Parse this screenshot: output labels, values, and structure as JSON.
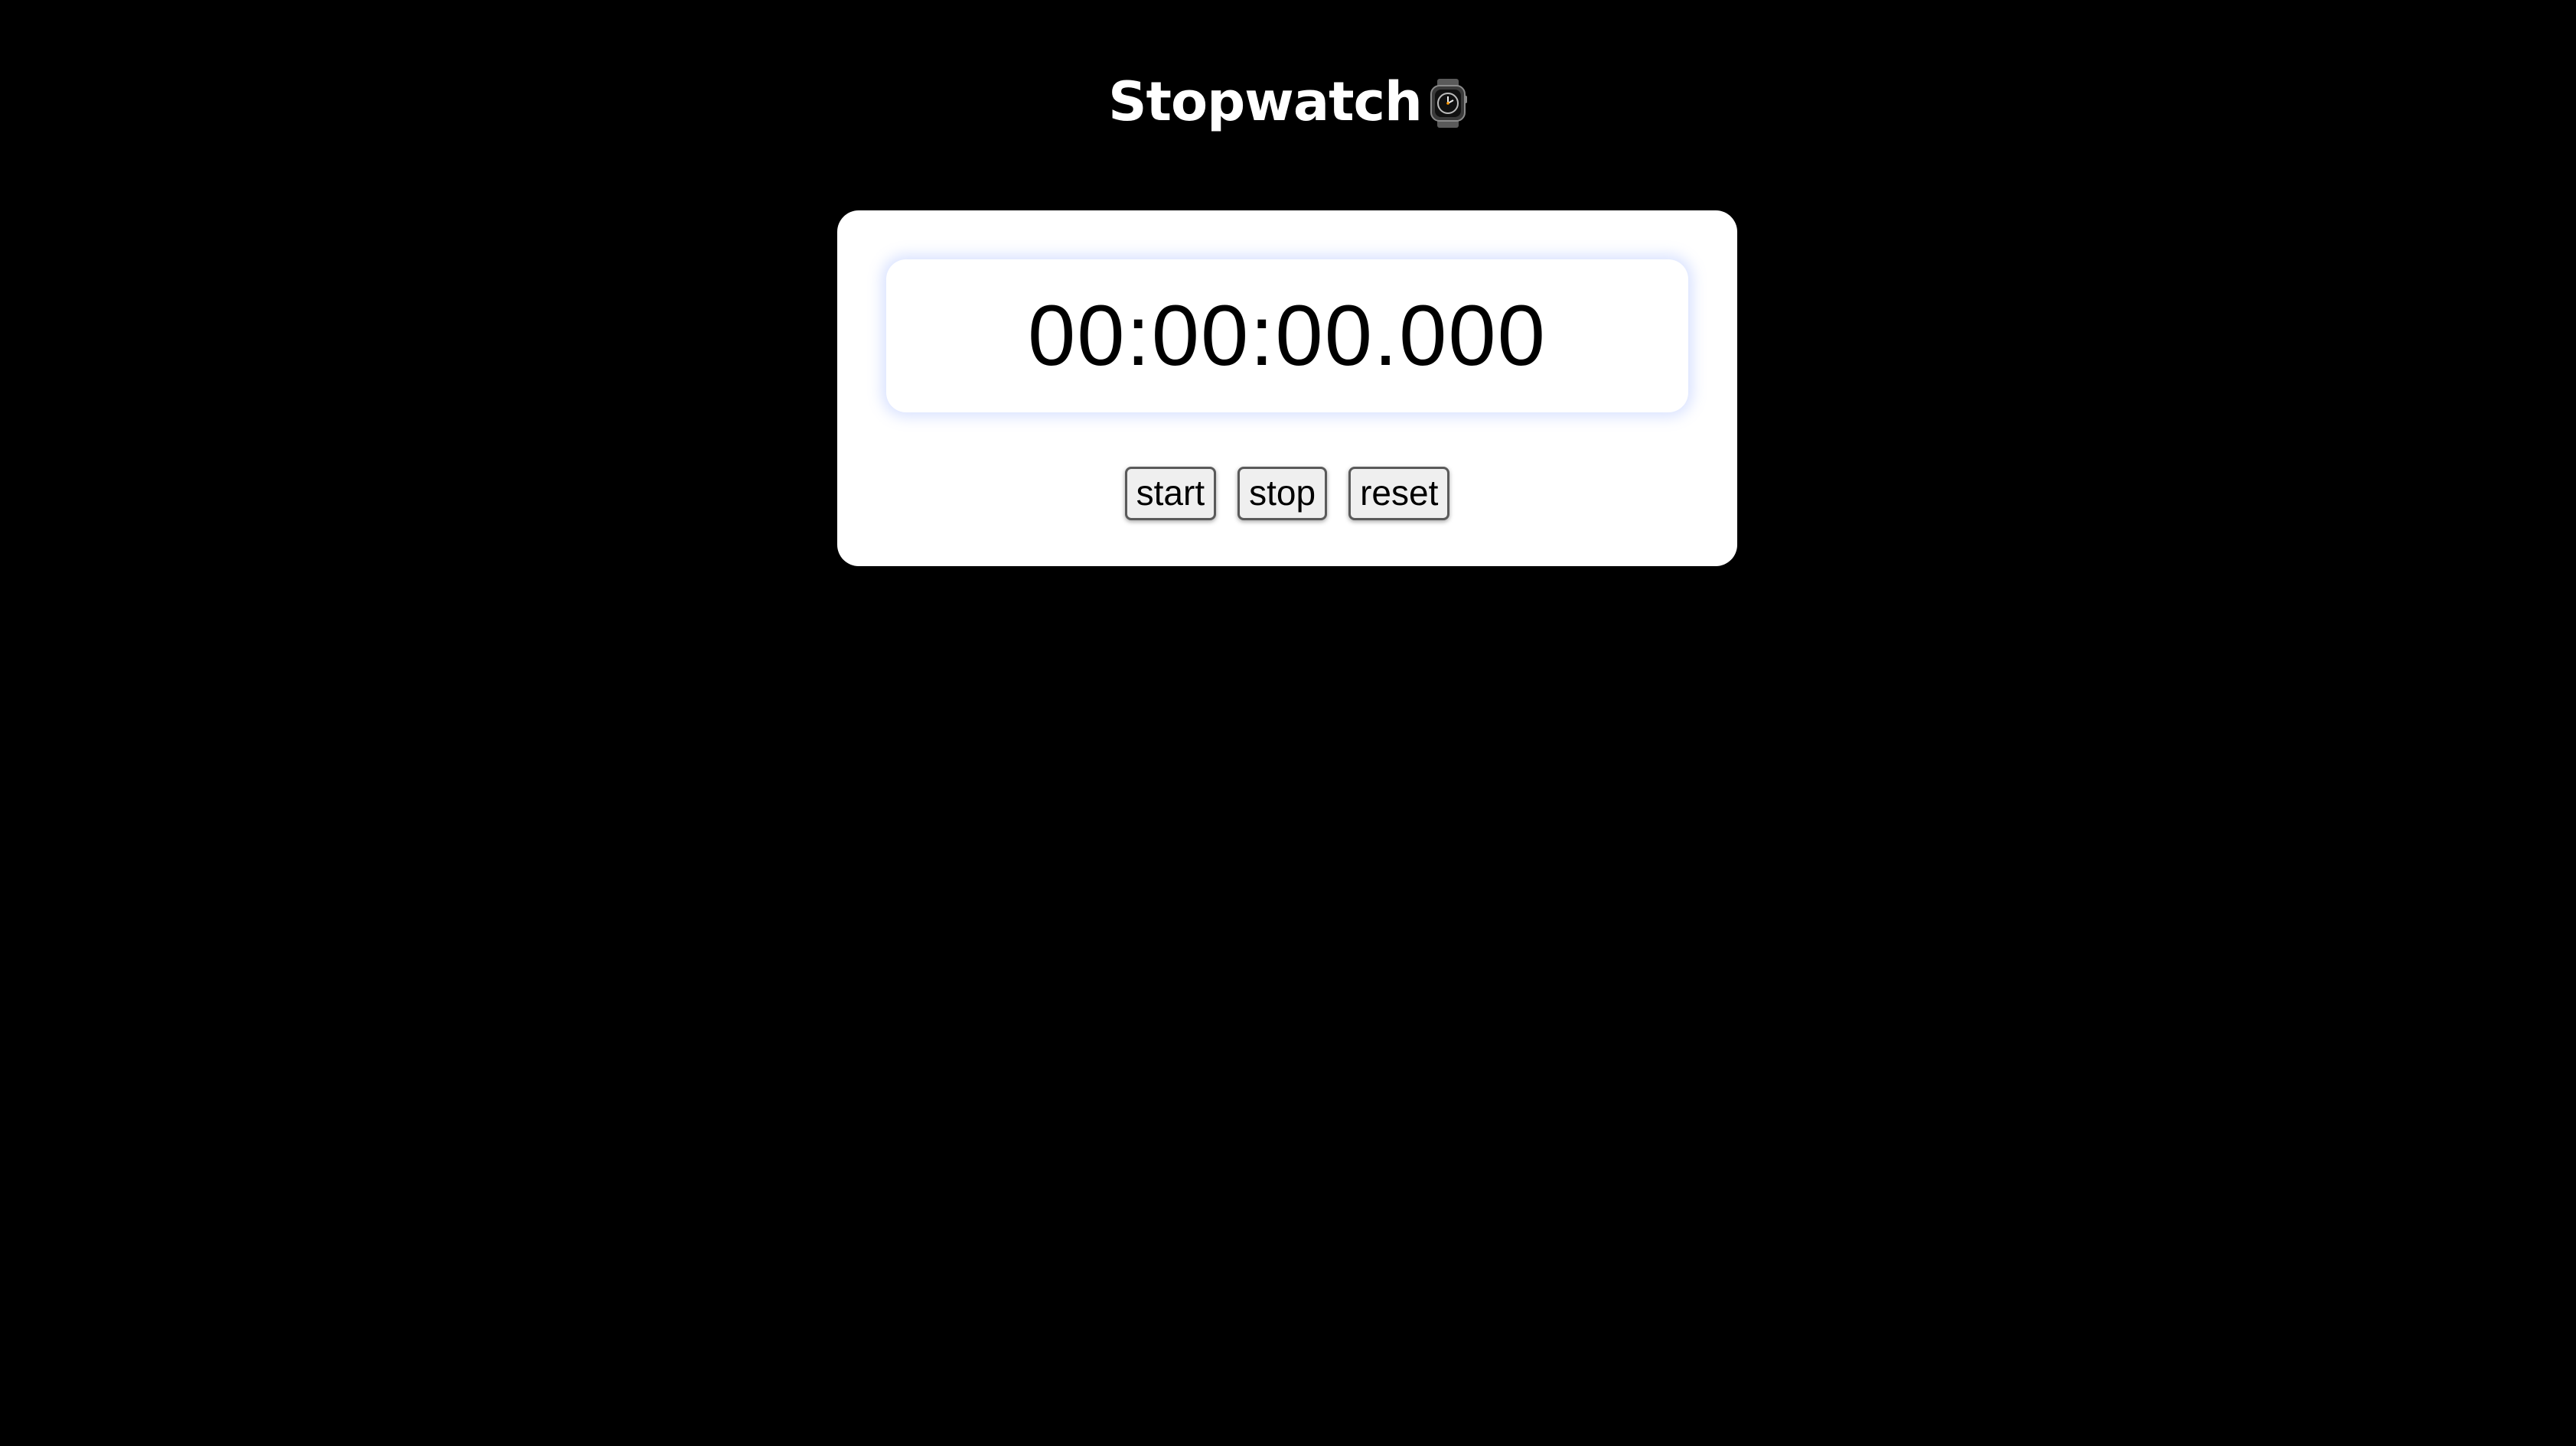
{
  "app": {
    "title": "Stopwatch",
    "title_icon": "watch-icon"
  },
  "stopwatch": {
    "time": "00:00:00.000"
  },
  "controls": {
    "start_label": "start",
    "stop_label": "stop",
    "reset_label": "reset"
  },
  "colors": {
    "background": "#000000",
    "card": "#ffffff",
    "display_glow": "#7896ff",
    "text": "#000000",
    "title": "#ffffff"
  }
}
